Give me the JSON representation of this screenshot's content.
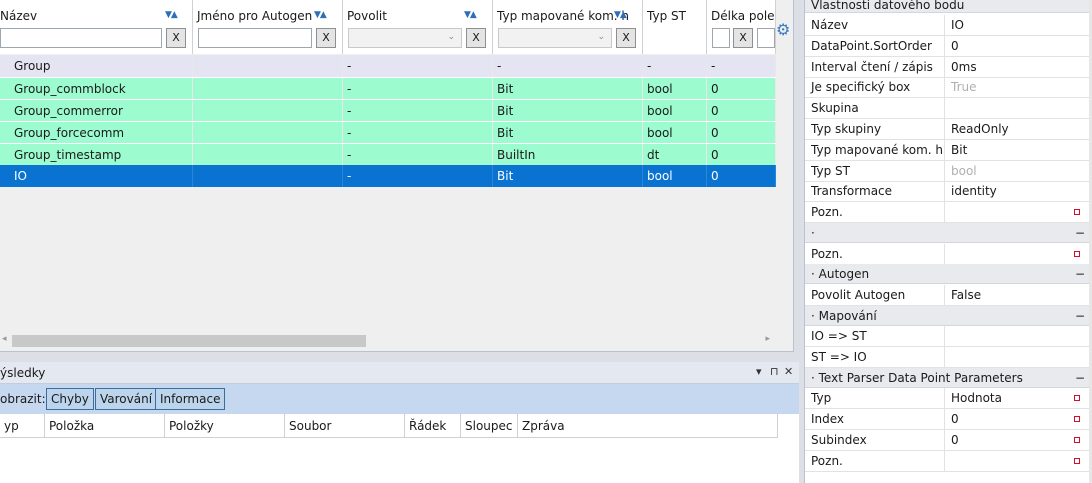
{
  "grid": {
    "columns": [
      {
        "title": "Název"
      },
      {
        "title": "Jméno pro Autogen"
      },
      {
        "title": "Povolit"
      },
      {
        "title": "Typ mapované kom. h"
      },
      {
        "title": "Typ ST"
      },
      {
        "title": "Délka pole"
      }
    ],
    "clear_label": "X",
    "rows": [
      {
        "name": "Group",
        "autogen": "",
        "povolit": "-",
        "typ_map": "-",
        "typ_st": "-",
        "delka": "-",
        "style": "group"
      },
      {
        "name": "Group_commblock",
        "autogen": "",
        "povolit": "-",
        "typ_map": "Bit",
        "typ_st": "bool",
        "delka": "0",
        "style": "green"
      },
      {
        "name": "Group_commerror",
        "autogen": "",
        "povolit": "-",
        "typ_map": "Bit",
        "typ_st": "bool",
        "delka": "0",
        "style": "green"
      },
      {
        "name": "Group_forcecomm",
        "autogen": "",
        "povolit": "-",
        "typ_map": "Bit",
        "typ_st": "bool",
        "delka": "0",
        "style": "green"
      },
      {
        "name": "Group_timestamp",
        "autogen": "",
        "povolit": "-",
        "typ_map": "BuiltIn",
        "typ_st": "dt",
        "delka": "0",
        "style": "green"
      },
      {
        "name": "IO",
        "autogen": "",
        "povolit": "-",
        "typ_map": "Bit",
        "typ_st": "bool",
        "delka": "0",
        "style": "sel"
      }
    ]
  },
  "results": {
    "title": "ýsledky",
    "pin": "▾ ⊓ ✕",
    "filter_label": "obrazit:",
    "filters": [
      "Chyby",
      "Varování",
      "Informace"
    ],
    "columns": [
      "yp",
      "Položka",
      "Položky",
      "Soubor",
      "Řádek",
      "Sloupec",
      "Zpráva"
    ]
  },
  "properties": {
    "title": "Vlastnosti datového bodu",
    "rows": [
      {
        "kind": "prop",
        "key": "Název",
        "value": "IO"
      },
      {
        "kind": "prop",
        "key": "DataPoint.SortOrder",
        "value": "0"
      },
      {
        "kind": "prop",
        "key": "Interval čtení / zápis",
        "value": "0ms"
      },
      {
        "kind": "prop",
        "key": "Je specifický box",
        "value": "True",
        "disabled": true
      },
      {
        "kind": "prop",
        "key": "Skupina",
        "value": ""
      },
      {
        "kind": "prop",
        "key": "Typ skupiny",
        "value": "ReadOnly"
      },
      {
        "kind": "prop",
        "key": "Typ mapované kom. h...",
        "value": "Bit"
      },
      {
        "kind": "prop",
        "key": "Typ ST",
        "value": "bool",
        "disabled": true
      },
      {
        "kind": "prop",
        "key": "Transformace",
        "value": "identity"
      },
      {
        "kind": "prop",
        "key": "Pozn.",
        "value": "",
        "marker": true
      },
      {
        "kind": "section",
        "key": "·"
      },
      {
        "kind": "prop",
        "key": "Pozn.",
        "value": "",
        "marker": true
      },
      {
        "kind": "section",
        "key": "·  Autogen"
      },
      {
        "kind": "prop",
        "key": "Povolit Autogen",
        "value": "False"
      },
      {
        "kind": "section",
        "key": "·  Mapování"
      },
      {
        "kind": "prop",
        "key": "IO => ST",
        "value": ""
      },
      {
        "kind": "prop",
        "key": "ST => IO",
        "value": ""
      },
      {
        "kind": "section",
        "key": "·  Text Parser Data Point Parameters"
      },
      {
        "kind": "prop",
        "key": "Typ",
        "value": "Hodnota",
        "marker": true
      },
      {
        "kind": "prop",
        "key": "Index",
        "value": "0",
        "marker": true
      },
      {
        "kind": "prop",
        "key": "Subindex",
        "value": "0",
        "marker": true
      },
      {
        "kind": "prop",
        "key": "Pozn.",
        "value": "",
        "marker": true
      }
    ]
  },
  "icons": {
    "sort": "sort-asc-desc-icon",
    "gear": "gear-icon",
    "marker": "modified-marker-icon"
  },
  "colors": {
    "group_row": "#e4e4f2",
    "green_row": "#9cfcd0",
    "selected_row": "#0a72d0",
    "accent": "#2d6fb8"
  }
}
